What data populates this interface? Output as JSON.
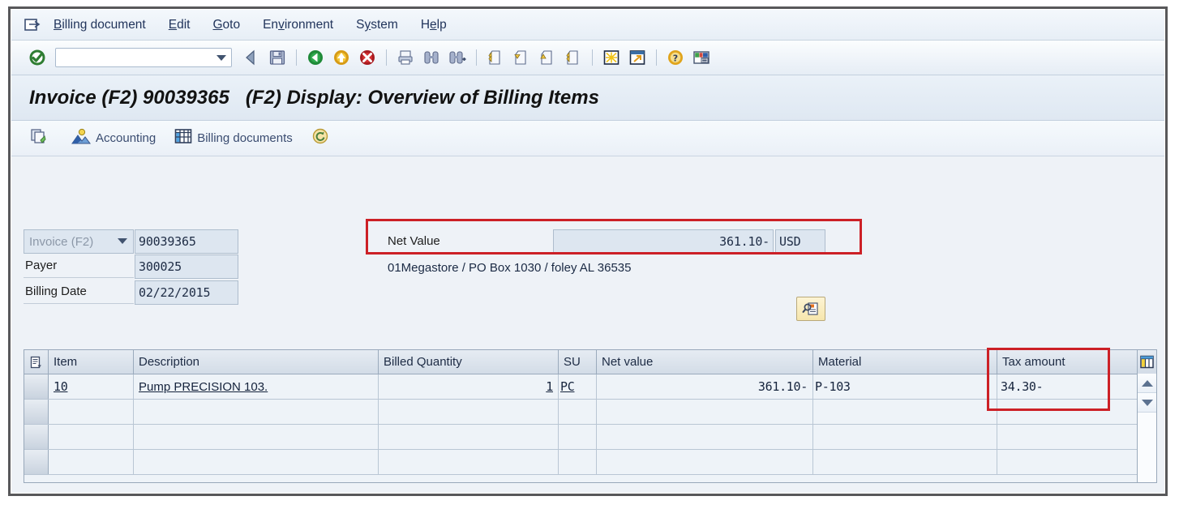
{
  "window": {
    "title": "Invoice (F2) 90039365   (F2) Display: Overview of Billing Items"
  },
  "menubar": {
    "system_icon": "window-list-icon",
    "items": [
      {
        "name": "billing-document",
        "pre": "",
        "acc": "B",
        "post": "illing document"
      },
      {
        "name": "edit",
        "pre": "",
        "acc": "E",
        "post": "dit"
      },
      {
        "name": "goto",
        "pre": "",
        "acc": "G",
        "post": "oto"
      },
      {
        "name": "environment",
        "pre": "En",
        "acc": "v",
        "post": "ironment"
      },
      {
        "name": "system",
        "pre": "S",
        "acc": "y",
        "post": "stem"
      },
      {
        "name": "help",
        "pre": "H",
        "acc": "e",
        "post": "lp"
      }
    ]
  },
  "toolbar": {
    "command_value": "",
    "command_placeholder": "",
    "icons": [
      "enter-check-icon",
      "back-arrow-icon",
      "save-icon",
      "back-green-icon",
      "exit-yellow-icon",
      "cancel-red-icon",
      "print-icon",
      "find-icon",
      "find-next-icon",
      "first-page-icon",
      "previous-page-icon",
      "next-page-icon",
      "last-page-icon",
      "create-session-icon",
      "create-shortcut-icon",
      "help-icon",
      "customize-layout-icon"
    ]
  },
  "app_toolbar": {
    "buttons": [
      {
        "name": "display-document-flow-button",
        "icon": "document-flow-icon",
        "label": ""
      },
      {
        "name": "accounting-button",
        "icon": "accounting-icon",
        "label": "Accounting"
      },
      {
        "name": "billing-documents-button",
        "icon": "billing-documents-icon",
        "label": "Billing documents"
      },
      {
        "name": "refresh-button",
        "icon": "refresh-coin-icon",
        "label": ""
      }
    ]
  },
  "form": {
    "doc_type": {
      "label": "Invoice (F2)",
      "value": "90039365"
    },
    "payer": {
      "label": "Payer",
      "value": "300025"
    },
    "billing_date": {
      "label": "Billing Date",
      "value": "02/22/2015"
    },
    "net_value": {
      "label": "Net Value",
      "value": "361.10-",
      "currency": "USD"
    },
    "address_text": "01Megastore / PO Box 1030 / foley AL 36535",
    "detail_button_icon": "display-detail-icon"
  },
  "highlights": {
    "color": "#cc2026",
    "regions": [
      "net-value-highlight",
      "tax-amount-highlight"
    ]
  },
  "table": {
    "select_all_icon": "select-all-icon",
    "column_config_icon": "column-config-icon",
    "columns": [
      {
        "name": "item",
        "label": "Item"
      },
      {
        "name": "description",
        "label": "Description"
      },
      {
        "name": "billed-quantity",
        "label": "Billed Quantity"
      },
      {
        "name": "su",
        "label": "SU"
      },
      {
        "name": "net-value",
        "label": "Net value"
      },
      {
        "name": "material",
        "label": "Material"
      },
      {
        "name": "tax-amount",
        "label": "Tax amount"
      }
    ],
    "rows": [
      {
        "item": "10",
        "description": "Pump PRECISION 103.",
        "billed_quantity": "1",
        "su": "PC",
        "net_value": "361.10-",
        "material": "P-103",
        "tax_amount": "34.30-"
      },
      {
        "item": "",
        "description": "",
        "billed_quantity": "",
        "su": "",
        "net_value": "",
        "material": "",
        "tax_amount": ""
      },
      {
        "item": "",
        "description": "",
        "billed_quantity": "",
        "su": "",
        "net_value": "",
        "material": "",
        "tax_amount": ""
      },
      {
        "item": "",
        "description": "",
        "billed_quantity": "",
        "su": "",
        "net_value": "",
        "material": "",
        "tax_amount": ""
      }
    ],
    "scroll_up_icon": "scroll-up-icon",
    "scroll_down_icon": "scroll-down-icon"
  }
}
